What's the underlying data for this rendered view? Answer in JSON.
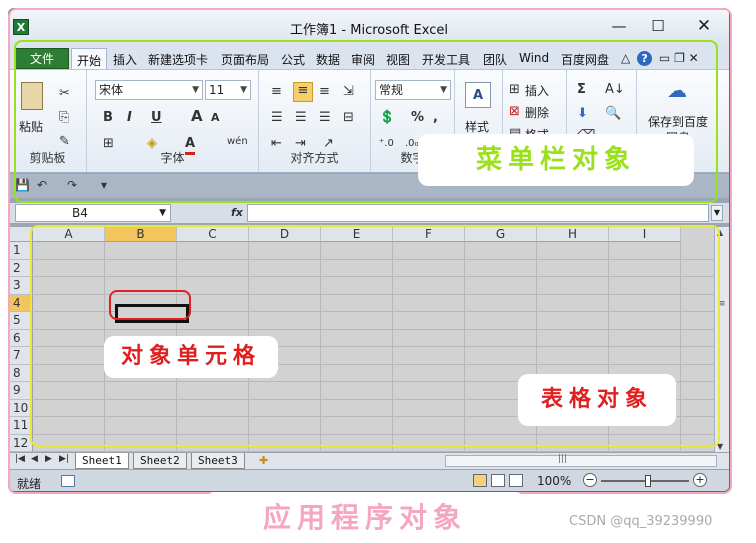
{
  "window": {
    "app_icon": "X",
    "title": "工作簿1 - Microsoft Excel",
    "controls": {
      "minimize": "—",
      "maximize": "☐",
      "close": "✕"
    }
  },
  "ribbon_tabs": {
    "file": "文件",
    "items": [
      "开始",
      "插入",
      "新建选项卡",
      "页面布局",
      "公式",
      "数据",
      "审阅",
      "视图",
      "开发工具",
      "团队",
      "Wind",
      "百度网盘"
    ],
    "active": "开始",
    "right_icons": {
      "collapse": "△",
      "help": "?",
      "min": "▭",
      "restore": "❐",
      "close": "✕"
    }
  },
  "ribbon": {
    "clipboard": {
      "paste": "粘贴",
      "label": "剪贴板"
    },
    "font": {
      "font_name": "宋体",
      "font_size": "11",
      "bold": "B",
      "italic": "I",
      "underline": "U",
      "grow": "A",
      "shrink": "A",
      "wen": "wén",
      "label": "字体"
    },
    "alignment": {
      "label": "对齐方式"
    },
    "number": {
      "format": "常规",
      "percent": "%",
      "comma": ",",
      "label": "数字"
    },
    "styles": {
      "label": "样式"
    },
    "cells": {
      "insert": "插入",
      "delete": "删除",
      "format": "格式"
    },
    "editing": {
      "sigma": "Σ"
    },
    "baidu": {
      "label": "保存到百度网盘"
    }
  },
  "formula_bar": {
    "name_box": "B4",
    "fx": "fx",
    "formula": ""
  },
  "grid": {
    "columns": [
      "A",
      "B",
      "C",
      "D",
      "E",
      "F",
      "G",
      "H",
      "I"
    ],
    "rows": [
      "1",
      "2",
      "3",
      "4",
      "5",
      "6",
      "7",
      "8",
      "9",
      "10",
      "11",
      "12"
    ],
    "selected_column": "B",
    "selected_row": "4"
  },
  "sheets": {
    "tabs": [
      "Sheet1",
      "Sheet2",
      "Sheet3"
    ],
    "active": "Sheet1"
  },
  "status": {
    "ready": "就绪",
    "zoom": "100%",
    "zoom_level": 1.0
  },
  "annotations": {
    "menu_bar": "菜单栏对象",
    "cell": "对象单元格",
    "table": "表格对象",
    "app": "应用程序对象",
    "colors": {
      "menu": "#9be01c",
      "cell": "#e02020",
      "table": "#e8e83a",
      "app": "#f5a7c0"
    }
  },
  "watermark": "CSDN @qq_39239990"
}
